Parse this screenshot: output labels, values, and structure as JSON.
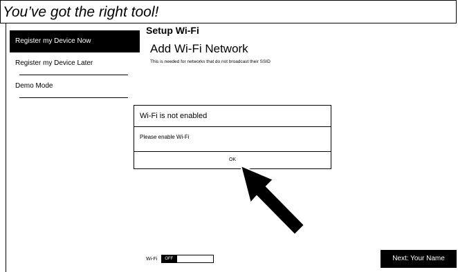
{
  "page_title": "You’ve got the right tool!",
  "sidebar": {
    "items": [
      {
        "label": "Register my Device Now",
        "active": true
      },
      {
        "label": "Register my Device Later",
        "active": false
      },
      {
        "label": "Demo Mode",
        "active": false
      }
    ]
  },
  "main": {
    "heading": "Setup Wi-Fi",
    "section_title": "Add Wi-Fi Network",
    "section_subtitle": "This is needed for networks that do not broadcast their SSID"
  },
  "dialog": {
    "title": "Wi-Fi is not enabled",
    "message": "Please enable Wi-Fi",
    "ok_label": "OK"
  },
  "footer": {
    "wifi_label": "Wi-Fi",
    "toggle_state": "OFF",
    "next_label": "Next: Your Name"
  },
  "colors": {
    "primary": "#000000",
    "background": "#ffffff"
  },
  "icons": {
    "pointer": "arrow-pointer-icon"
  }
}
